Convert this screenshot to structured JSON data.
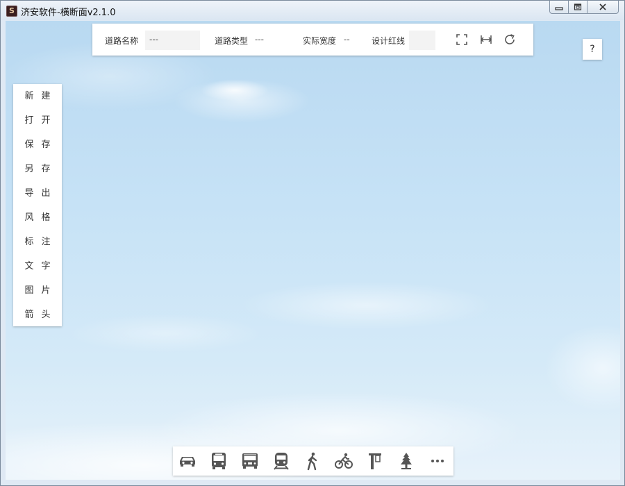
{
  "window": {
    "title": "济安软件-横断面v2.1.0",
    "app_icon_letter": "S",
    "controls": [
      "minimize-icon",
      "maximize-icon",
      "close-icon"
    ]
  },
  "info_bar": {
    "road_name_label": "道路名称",
    "road_name_value": "---",
    "road_type_label": "道路类型",
    "road_type_value": "---",
    "actual_width_label": "实际宽度",
    "actual_width_value": "--",
    "design_red_line_label": "设计红线",
    "design_red_line_value": "",
    "tools": [
      "fullscreen-icon",
      "fit-width-icon",
      "refresh-icon"
    ]
  },
  "help_button": "?",
  "side_menu": {
    "items": [
      {
        "label": "新建"
      },
      {
        "label": "打开"
      },
      {
        "label": "保存"
      },
      {
        "label": "另存"
      },
      {
        "label": "导出"
      },
      {
        "label": "风格"
      },
      {
        "label": "标注"
      },
      {
        "label": "文字"
      },
      {
        "label": "图片"
      },
      {
        "label": "箭头"
      }
    ]
  },
  "bottom_toolbar": {
    "items": [
      "car-icon",
      "bus-icon",
      "tram-icon",
      "train-icon",
      "pedestrian-icon",
      "bicycle-icon",
      "street-sign-icon",
      "tree-icon",
      "more-icon"
    ]
  },
  "colors": {
    "icon": "#555555",
    "sky_top": "#b9d9f1",
    "sky_bottom": "#e7f2fa",
    "panel": "#ffffff"
  }
}
